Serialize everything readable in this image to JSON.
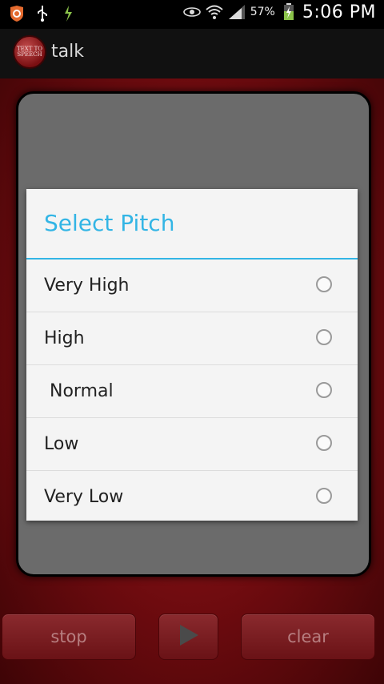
{
  "status_bar": {
    "battery_percent": "57%",
    "time": "5:06 PM",
    "icons_left": [
      "shield-app-icon",
      "usb-icon",
      "plug-icon"
    ],
    "icons_right": [
      "eye-icon",
      "wifi-icon",
      "signal-icon",
      "battery-charging-icon"
    ]
  },
  "app_bar": {
    "logo_text": "TEXT TO SPEECH",
    "title": "talk"
  },
  "dialog": {
    "title": "Select Pitch",
    "options": [
      {
        "label": "Very High",
        "selected": false
      },
      {
        "label": "High",
        "selected": false
      },
      {
        "label": " Normal",
        "selected": false
      },
      {
        "label": "Low",
        "selected": false
      },
      {
        "label": "Very Low",
        "selected": false
      }
    ]
  },
  "buttons": {
    "stop": "stop",
    "play_icon": "play-icon",
    "clear": "clear"
  },
  "colors": {
    "accent": "#33b5e5",
    "background_red": "#7a0f12"
  }
}
